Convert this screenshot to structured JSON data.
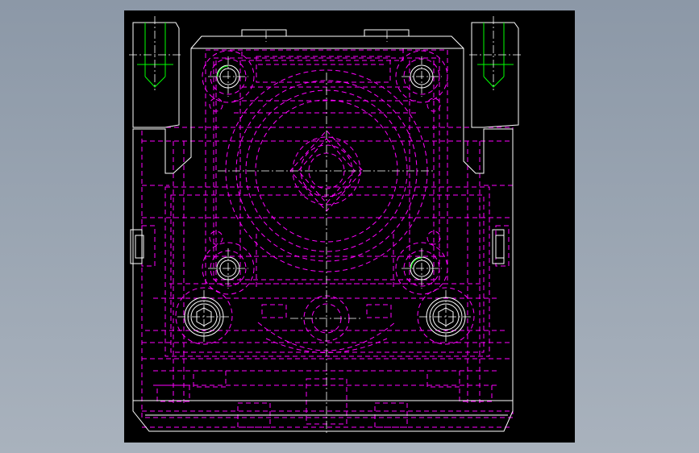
{
  "colors": {
    "background": "#8c98a7",
    "canvas": "#000000",
    "outline": "#ffffff",
    "hidden": "#ff00ff",
    "center": "#ffffff",
    "thread": "#00ff00"
  },
  "drawing": {
    "view": "front",
    "visible_outline_style": "solid",
    "hidden_line_style": "dashed",
    "center_line_style": "dash-dot"
  }
}
